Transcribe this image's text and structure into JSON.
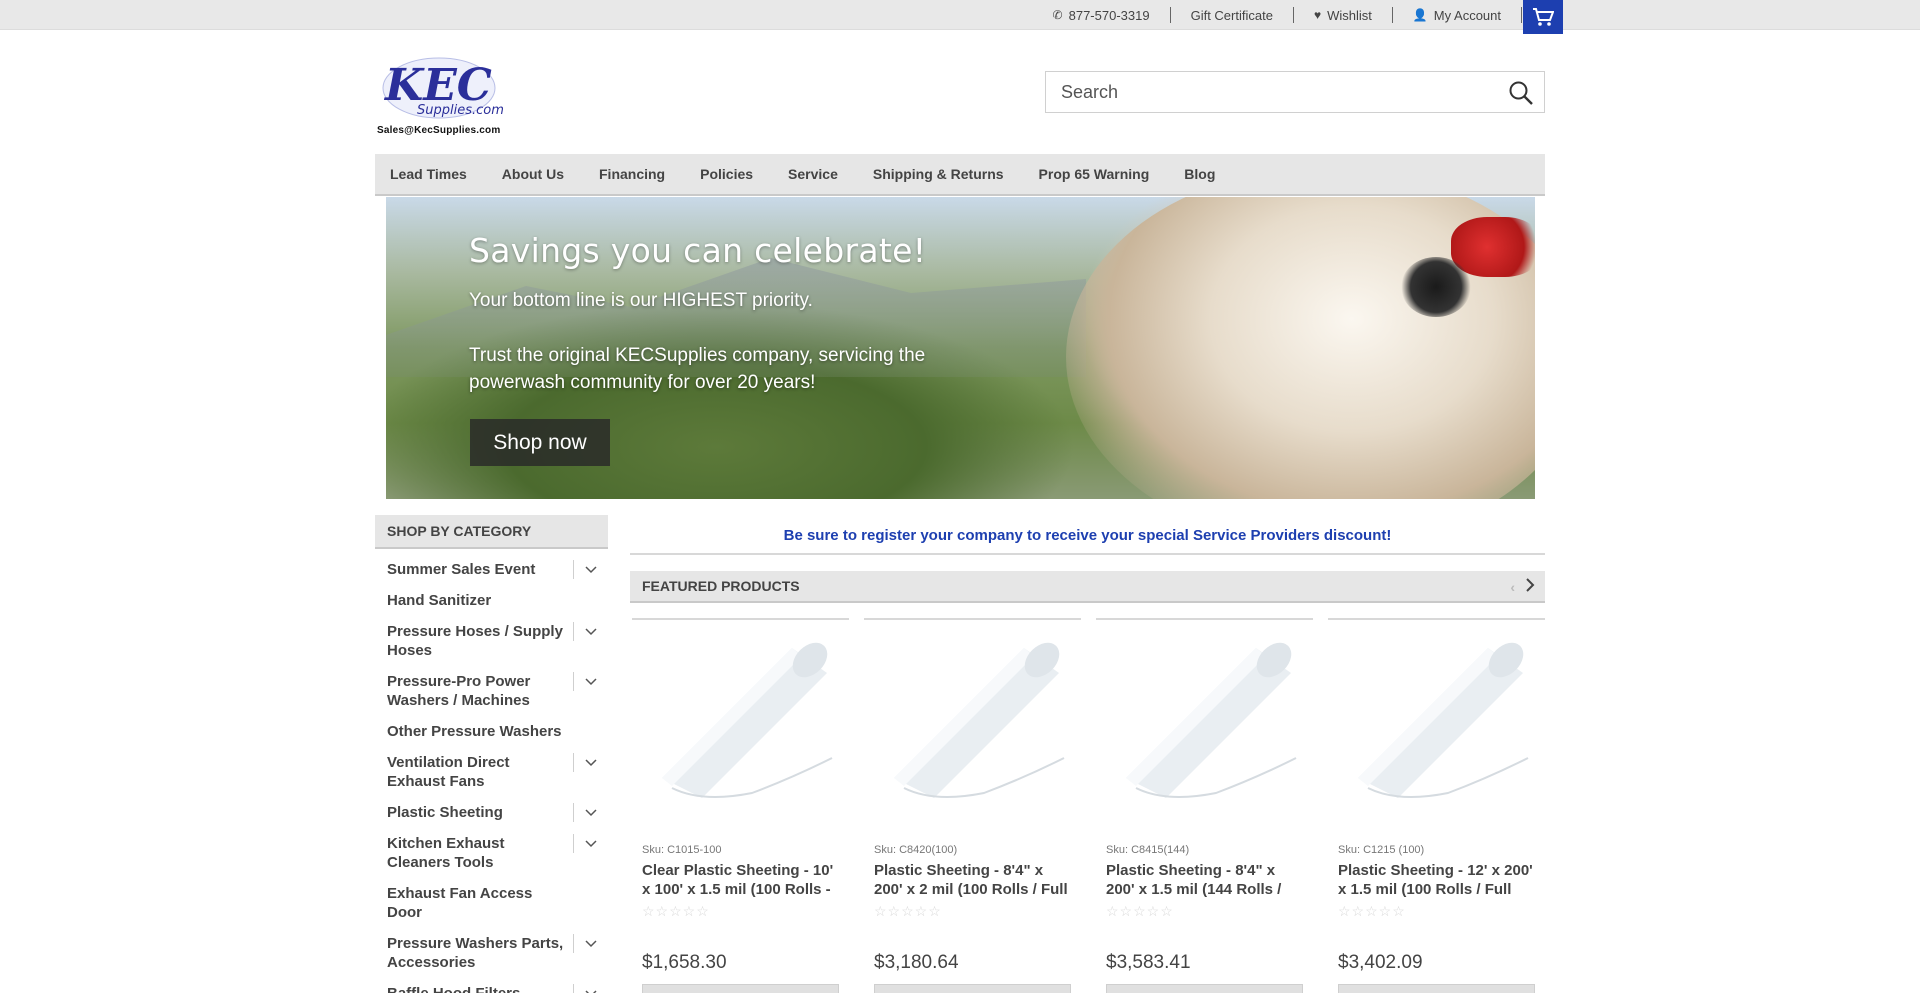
{
  "topbar": {
    "phone": "877-570-3319",
    "gift": "Gift Certificate",
    "wishlist": "Wishlist",
    "account": "My Account"
  },
  "header": {
    "logo_caption": "Sales@KecSupplies.com",
    "search_placeholder": "Search"
  },
  "nav": [
    "Lead Times",
    "About Us",
    "Financing",
    "Policies",
    "Service",
    "Shipping & Returns",
    "Prop 65 Warning",
    "Blog"
  ],
  "hero": {
    "title": "Savings you can celebrate!",
    "subtitle": "Your bottom line is our HIGHEST priority.",
    "text": "Trust the original KECSupplies company, servicing the powerwash community for over 20 years!",
    "button": "Shop now"
  },
  "sidebar": {
    "heading": "SHOP BY CATEGORY",
    "categories": [
      {
        "label": "Summer Sales Event",
        "expandable": true
      },
      {
        "label": "Hand Sanitizer",
        "expandable": false
      },
      {
        "label": "Pressure Hoses / Supply Hoses",
        "expandable": true
      },
      {
        "label": "Pressure-Pro Power Washers / Machines",
        "expandable": true
      },
      {
        "label": "Other Pressure Washers",
        "expandable": false
      },
      {
        "label": "Ventilation Direct Exhaust Fans",
        "expandable": true
      },
      {
        "label": "Plastic Sheeting",
        "expandable": true
      },
      {
        "label": "Kitchen Exhaust Cleaners Tools",
        "expandable": true
      },
      {
        "label": "Exhaust Fan Access Door",
        "expandable": false
      },
      {
        "label": "Pressure Washers Parts, Accessories",
        "expandable": true
      },
      {
        "label": "Baffle Hood Filters",
        "expandable": true
      }
    ]
  },
  "main": {
    "promo": "Be sure to register your company to receive your special Service Providers discount!",
    "featured_heading": "FEATURED PRODUCTS",
    "products": [
      {
        "sku": "Sku: C1015-100",
        "title": "Clear Plastic Sheeting - 10' x 100' x 1.5 mil (100 Rolls -",
        "stars": "☆☆☆☆☆",
        "price": "$1,658.30"
      },
      {
        "sku": "Sku: C8420(100)",
        "title": "Plastic Sheeting - 8'4\" x 200' x 2 mil (100 Rolls / Full",
        "stars": "☆☆☆☆☆",
        "price": "$3,180.64"
      },
      {
        "sku": "Sku: C8415(144)",
        "title": "Plastic Sheeting - 8'4\" x 200' x 1.5 mil (144 Rolls / Full",
        "stars": "☆☆☆☆☆",
        "price": "$3,583.41"
      },
      {
        "sku": "Sku: C1215 (100)",
        "title": "Plastic Sheeting - 12' x 200' x 1.5 mil (100 Rolls / Full",
        "stars": "☆☆☆☆☆",
        "price": "$3,402.09"
      }
    ]
  },
  "colors": {
    "accent": "#1d3fb0",
    "bar": "#e6e6e6"
  }
}
